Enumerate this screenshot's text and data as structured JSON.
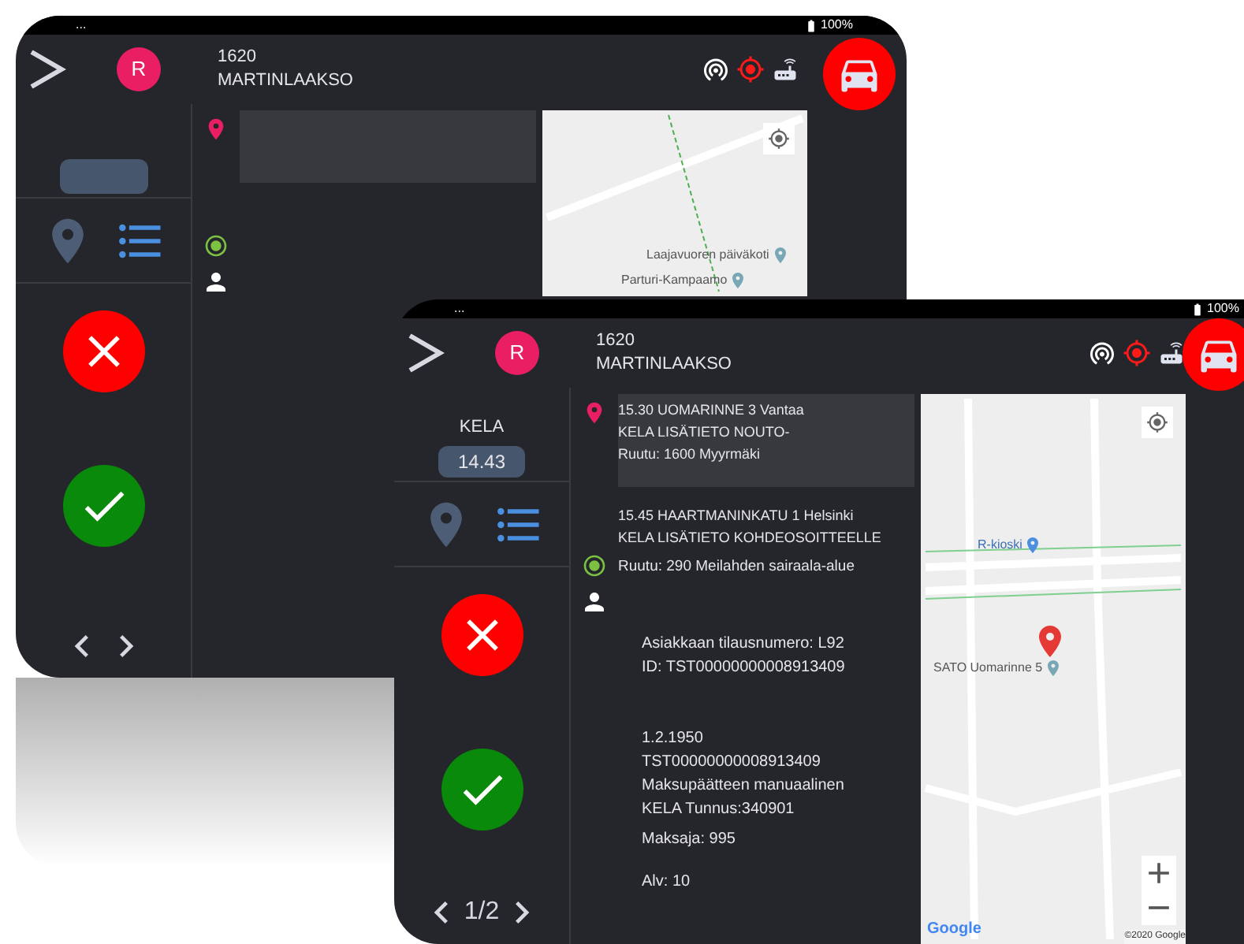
{
  "back_screen": {
    "status_bar": {
      "notice": "...",
      "battery": "100%"
    },
    "header": {
      "avatar": "R",
      "vehicle_number": "1620",
      "area": "MARTINLAAKSO"
    },
    "sidebar": {
      "badge_empty": true
    },
    "stops": [
      {
        "selected": true
      }
    ],
    "map": {
      "places": [
        {
          "name": "Laajavuoren päiväkoti"
        },
        {
          "name": "Parturi-Kampaamo"
        }
      ]
    }
  },
  "front_screen": {
    "status_bar": {
      "notice": "...",
      "battery": "100%"
    },
    "header": {
      "avatar": "R",
      "vehicle_number": "1620",
      "area": "MARTINLAAKSO"
    },
    "sidebar": {
      "category": "KELA",
      "time": "14.43",
      "page": "1/2"
    },
    "stops": [
      {
        "selected": true,
        "lines": [
          "15.30 UOMARINNE 3 Vantaa",
          "KELA LISÄTIETO NOUTO-",
          "Ruutu: 1600 Myyrmäki"
        ]
      },
      {
        "selected": false,
        "lines": [
          "15.45 HAARTMANINKATU 1 Helsinki",
          "KELA LISÄTIETO KOHDEOSOITTEELLE"
        ]
      }
    ],
    "destination": "Ruutu: 290 Meilahden sairaala-alue",
    "customer": [
      [
        "Asiakkaan tilausnumero: L92",
        "ID: TST00000000008913409"
      ],
      [
        "1.2.1950",
        "TST00000000008913409",
        "Maksupäätteen manuaalinen",
        "KELA Tunnus:340901"
      ],
      [
        "Maksaja: 995"
      ],
      [
        "Alv: 10"
      ]
    ],
    "map": {
      "places": [
        {
          "name": "R-kioski"
        },
        {
          "name": "SATO Uomarinne 5"
        }
      ],
      "logo": "Google",
      "copyright": "©2020 Google"
    }
  }
}
